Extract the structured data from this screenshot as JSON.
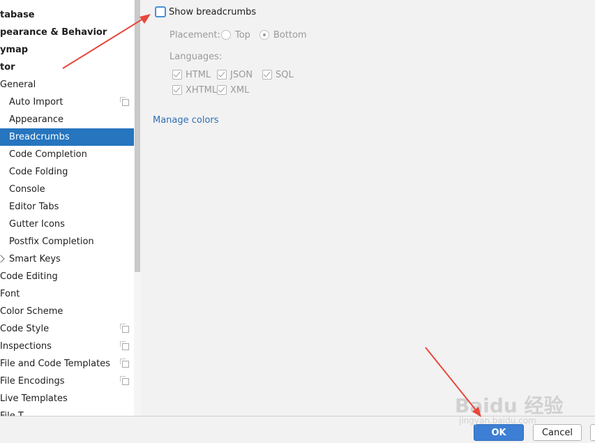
{
  "sidebar": {
    "items": [
      {
        "label": "tabase",
        "bold": true,
        "indent": 0,
        "icon": null
      },
      {
        "label": "pearance & Behavior",
        "bold": true,
        "indent": 0,
        "icon": null
      },
      {
        "label": "ymap",
        "bold": true,
        "indent": 0,
        "icon": null
      },
      {
        "label": "tor",
        "bold": true,
        "indent": 0,
        "icon": null
      },
      {
        "label": "General",
        "bold": false,
        "indent": 0,
        "icon": null
      },
      {
        "label": "Auto Import",
        "bold": false,
        "indent": 13,
        "icon": "copy-icon"
      },
      {
        "label": "Appearance",
        "bold": false,
        "indent": 13,
        "icon": null
      },
      {
        "label": "Breadcrumbs",
        "bold": false,
        "indent": 13,
        "icon": null,
        "selected": true
      },
      {
        "label": "Code Completion",
        "bold": false,
        "indent": 13,
        "icon": null
      },
      {
        "label": "Code Folding",
        "bold": false,
        "indent": 13,
        "icon": null
      },
      {
        "label": "Console",
        "bold": false,
        "indent": 13,
        "icon": null
      },
      {
        "label": "Editor Tabs",
        "bold": false,
        "indent": 13,
        "icon": null
      },
      {
        "label": "Gutter Icons",
        "bold": false,
        "indent": 13,
        "icon": null
      },
      {
        "label": "Postfix Completion",
        "bold": false,
        "indent": 13,
        "icon": null
      },
      {
        "label": "Smart Keys",
        "bold": false,
        "indent": 13,
        "icon": null,
        "expandable": true
      },
      {
        "label": "Code Editing",
        "bold": false,
        "indent": 0,
        "icon": null
      },
      {
        "label": "Font",
        "bold": false,
        "indent": 0,
        "icon": null
      },
      {
        "label": "Color Scheme",
        "bold": false,
        "indent": 0,
        "icon": null
      },
      {
        "label": "Code Style",
        "bold": false,
        "indent": 0,
        "icon": "copy-icon"
      },
      {
        "label": "Inspections",
        "bold": false,
        "indent": 0,
        "icon": "copy-icon"
      },
      {
        "label": "File and Code Templates",
        "bold": false,
        "indent": 0,
        "icon": "copy-icon"
      },
      {
        "label": "File Encodings",
        "bold": false,
        "indent": 0,
        "icon": "copy-icon"
      },
      {
        "label": "Live Templates",
        "bold": false,
        "indent": 0,
        "icon": null
      },
      {
        "label": "File T",
        "bold": false,
        "indent": 0,
        "icon": null
      }
    ],
    "selected_color": "#2675bf"
  },
  "breadcrumbs_settings": {
    "show_breadcrumbs": {
      "label": "Show breadcrumbs",
      "checked": false
    },
    "placement": {
      "label": "Placement:",
      "options": [
        {
          "label": "Top",
          "selected": false
        },
        {
          "label": "Bottom",
          "selected": true
        }
      ]
    },
    "languages": {
      "label": "Languages:",
      "items": [
        {
          "label": "HTML",
          "checked": true
        },
        {
          "label": "JSON",
          "checked": true
        },
        {
          "label": "SQL",
          "checked": true
        },
        {
          "label": "XHTML",
          "checked": true
        },
        {
          "label": "XML",
          "checked": true
        }
      ]
    },
    "manage_colors": "Manage colors"
  },
  "buttons": {
    "ok": "OK",
    "cancel": "Cancel"
  },
  "watermark": {
    "main": "Baidu 经验",
    "sub": "jingyan.baidu.com"
  },
  "colors": {
    "accent": "#3d7fd4",
    "link": "#2d6fb5",
    "annotation_arrow": "#e8473b"
  }
}
